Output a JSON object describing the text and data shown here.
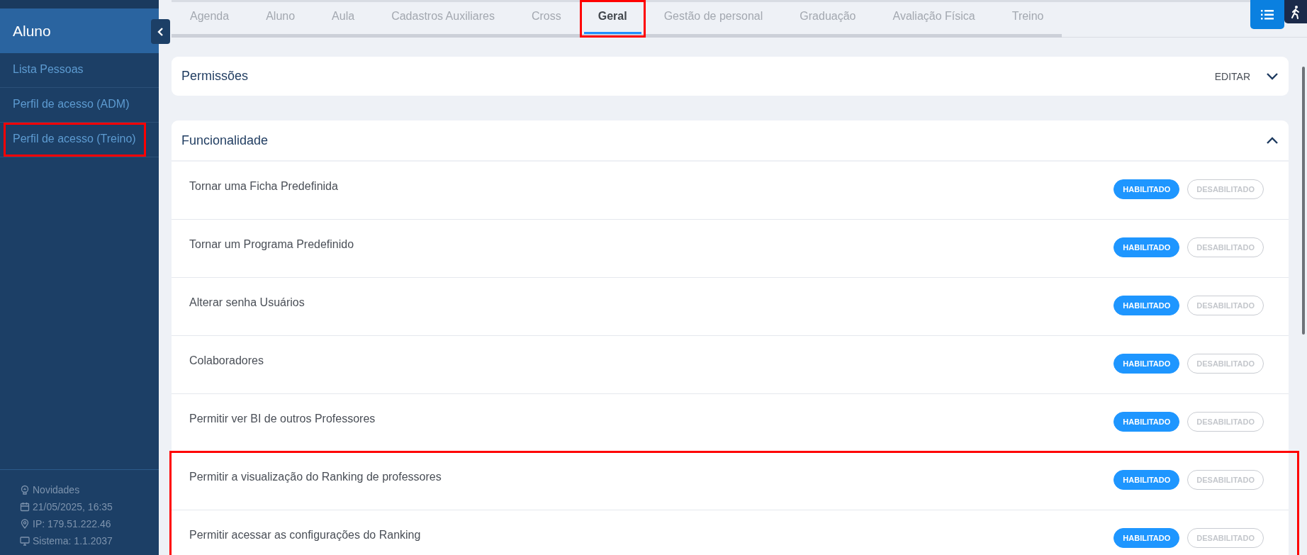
{
  "sidebar": {
    "title": "Aluno",
    "items": [
      {
        "label": "Lista Pessoas",
        "highlighted": false
      },
      {
        "label": "Perfil de acesso (ADM)",
        "highlighted": false
      },
      {
        "label": "Perfil de acesso (Treino)",
        "highlighted": true
      }
    ],
    "footer": [
      {
        "kind": "bulb",
        "text": "Novidades"
      },
      {
        "kind": "calendar",
        "text": "21/05/2025, 16:35"
      },
      {
        "kind": "pin",
        "text": "IP: 179.51.222.46"
      },
      {
        "kind": "monitor",
        "text": "Sistema: 1.1.2037"
      }
    ]
  },
  "tabs": [
    {
      "label": "Agenda",
      "selected": false,
      "highlighted": false
    },
    {
      "label": "Aluno",
      "selected": false,
      "highlighted": false
    },
    {
      "label": "Aula",
      "selected": false,
      "highlighted": false
    },
    {
      "label": "Cadastros Auxiliares",
      "selected": false,
      "highlighted": false
    },
    {
      "label": "Cross",
      "selected": false,
      "highlighted": false
    },
    {
      "label": "Geral",
      "selected": true,
      "highlighted": true
    },
    {
      "label": "Gestão de personal",
      "selected": false,
      "highlighted": false
    },
    {
      "label": "Graduação",
      "selected": false,
      "highlighted": false
    },
    {
      "label": "Avaliação Física",
      "selected": false,
      "highlighted": false
    },
    {
      "label": "Treino",
      "selected": false,
      "highlighted": false
    }
  ],
  "permissoes": {
    "title": "Permissões",
    "action": "EDITAR",
    "expanded": false
  },
  "funcionalidade": {
    "title": "Funcionalidade",
    "expanded": true,
    "rows": [
      {
        "label": "Tornar uma Ficha Predefinida",
        "highlighted": false,
        "options": [
          {
            "label": "HABILITADO",
            "selected": true
          },
          {
            "label": "DESABILITADO",
            "selected": false
          }
        ]
      },
      {
        "label": "Tornar um Programa Predefinido",
        "highlighted": false,
        "options": [
          {
            "label": "HABILITADO",
            "selected": true
          },
          {
            "label": "DESABILITADO",
            "selected": false
          }
        ]
      },
      {
        "label": "Alterar senha Usuários",
        "highlighted": false,
        "options": [
          {
            "label": "HABILITADO",
            "selected": true
          },
          {
            "label": "DESABILITADO",
            "selected": false
          }
        ]
      },
      {
        "label": "Colaboradores",
        "highlighted": false,
        "options": [
          {
            "label": "HABILITADO",
            "selected": true
          },
          {
            "label": "DESABILITADO",
            "selected": false
          }
        ]
      },
      {
        "label": "Permitir ver BI de outros Professores",
        "highlighted": false,
        "options": [
          {
            "label": "HABILITADO",
            "selected": true
          },
          {
            "label": "DESABILITADO",
            "selected": false
          }
        ]
      },
      {
        "label": "Permitir a visualização do Ranking de professores",
        "highlighted": true,
        "options": [
          {
            "label": "HABILITADO",
            "selected": true
          },
          {
            "label": "DESABILITADO",
            "selected": false
          }
        ]
      },
      {
        "label": "Permitir acessar as configurações do Ranking",
        "highlighted": true,
        "options": [
          {
            "label": "HABILITADO",
            "selected": true
          },
          {
            "label": "DESABILITADO",
            "selected": false
          }
        ]
      }
    ]
  }
}
